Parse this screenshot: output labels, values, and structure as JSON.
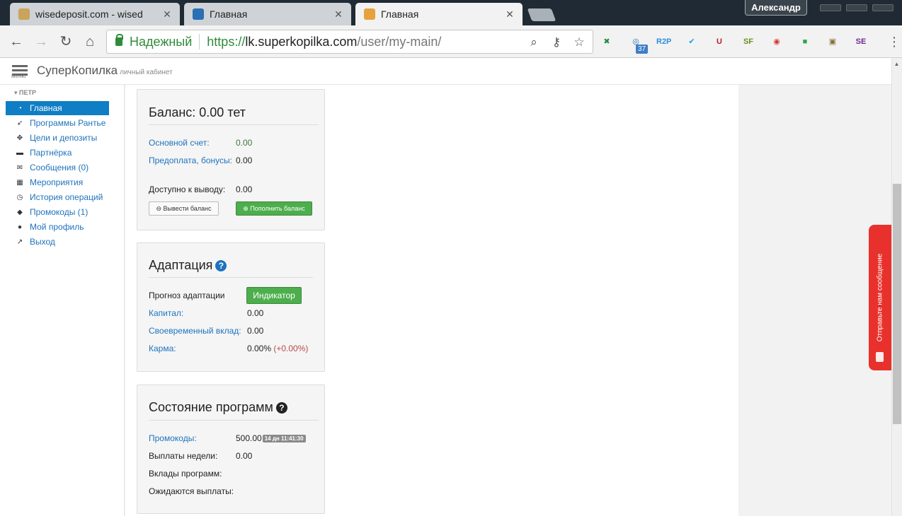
{
  "browser": {
    "tabs": [
      {
        "title": "wisedeposit.com - wised",
        "favicon_color": "#c9a45a"
      },
      {
        "title": "Главная",
        "favicon_color": "#2b6fb5"
      },
      {
        "title": "Главная",
        "favicon_color": "#e6a23c"
      }
    ],
    "user_name": "Александр",
    "secure_label": "Надежный",
    "url_scheme": "https://",
    "url_host": "lk.superkopilka.com",
    "url_path": "/user/my-main/",
    "extension_badge": "37",
    "extensions": [
      {
        "name": "x-extension-icon",
        "glyph": "✖",
        "color": "#1d8f3a"
      },
      {
        "name": "radar-extension-icon",
        "glyph": "◎",
        "color": "#2b6fb5"
      },
      {
        "name": "r2p-extension-icon",
        "glyph": "R2P",
        "color": "#2b8fd9"
      },
      {
        "name": "check-extension-icon",
        "glyph": "✔",
        "color": "#1e9be9"
      },
      {
        "name": "magnet-extension-icon",
        "glyph": "U",
        "color": "#c0172b"
      },
      {
        "name": "sf-extension-icon",
        "glyph": "SF",
        "color": "#6b8e23"
      },
      {
        "name": "bird-extension-icon",
        "glyph": "◉",
        "color": "#d33"
      },
      {
        "name": "cube-extension-icon",
        "glyph": "■",
        "color": "#2aa84a"
      },
      {
        "name": "monitor-extension-icon",
        "glyph": "▣",
        "color": "#8a6d3b"
      },
      {
        "name": "se-extension-icon",
        "glyph": "SE",
        "color": "#6a2b8f"
      }
    ]
  },
  "header": {
    "menu_label": "меню",
    "brand": "СуперКопилка",
    "brand_sub": "личный кабинет"
  },
  "sidebar": {
    "group": "ПЕТР",
    "items": [
      {
        "label": "Главная",
        "icon": "dashboard-icon",
        "glyph": "◔",
        "active": true
      },
      {
        "label": "Программы Рантье",
        "icon": "rocket-icon",
        "glyph": "➶"
      },
      {
        "label": "Цели и депозиты",
        "icon": "crosshair-icon",
        "glyph": "✥"
      },
      {
        "label": "Партнёрка",
        "icon": "briefcase-icon",
        "glyph": "▬"
      },
      {
        "label": "Сообщения (0)",
        "icon": "envelope-icon",
        "glyph": "✉"
      },
      {
        "label": "Мероприятия",
        "icon": "film-icon",
        "glyph": "▦"
      },
      {
        "label": "История операций",
        "icon": "clock-icon",
        "glyph": "◷"
      },
      {
        "label": "Промокоды (1)",
        "icon": "tag-icon",
        "glyph": "◆"
      },
      {
        "label": "Мой профиль",
        "icon": "user-icon",
        "glyph": "●"
      },
      {
        "label": "Выход",
        "icon": "exit-icon",
        "glyph": "↗"
      }
    ]
  },
  "balance": {
    "title": "Баланс: 0.00 тет",
    "main_account_label": "Основной счет:",
    "main_account_value": "0.00",
    "prepay_label": "Предоплата, бонусы:",
    "prepay_value": "0.00",
    "available_label": "Доступно к выводу:",
    "available_value": "0.00",
    "withdraw_button": "Вывести баланс",
    "topup_button": "Пополнить баланс"
  },
  "adaptation": {
    "title": "Адаптация",
    "forecast_label": "Прогноз адаптации",
    "indicator_button": "Индикатор",
    "capital_label": "Капитал:",
    "capital_value": "0.00",
    "timely_label": "Своевременный вклад:",
    "timely_value": "0.00",
    "karma_label": "Карма:",
    "karma_value": "0.00%",
    "karma_delta": "(+0.00%)",
    "help_icon_color": "#1e73be"
  },
  "programs": {
    "title": "Состояние программ",
    "promo_label": "Промокоды:",
    "promo_value": "500.00",
    "promo_timer": "14 дн 11:41:30",
    "weekly_label": "Выплаты недели:",
    "weekly_value": "0.00",
    "deposits_label": "Вклады программ:",
    "pending_label": "Ожидаются выплаты:",
    "help_icon_color": "#222222"
  },
  "feedback": {
    "label": "Отправьте нам сообщение",
    "color": "#e8312c"
  },
  "colors": {
    "active_nav": "#0f7ec4",
    "link": "#1e73be",
    "success": "#4cae4c"
  }
}
